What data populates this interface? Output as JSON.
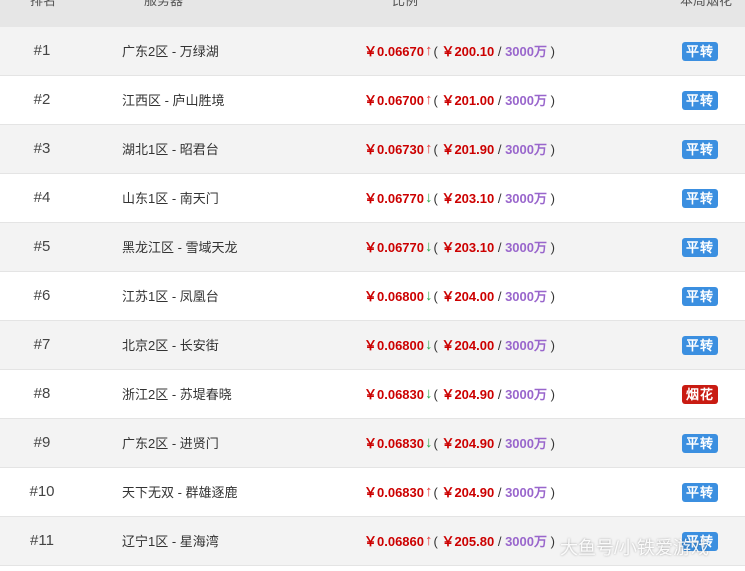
{
  "header": {
    "rank": "排名",
    "server": "服务器",
    "ratio": "比例",
    "status": "本周烟花"
  },
  "colors": {
    "price_red": "#cc0000",
    "count_purple": "#9966cc",
    "arrow_up": "#e83b3b",
    "arrow_down": "#2ea84a",
    "badge_blue": "#3b8fe0",
    "badge_red": "#c91b12"
  },
  "rows": [
    {
      "rank": "#1",
      "server": "广东2区 - 万绿湖",
      "ratio": "￥0.06670",
      "arrow": "↑",
      "price": "￥200.10",
      "count": "3000万",
      "status": "平转"
    },
    {
      "rank": "#2",
      "server": "江西区 - 庐山胜境",
      "ratio": "￥0.06700",
      "arrow": "↑",
      "price": "￥201.00",
      "count": "3000万",
      "status": "平转"
    },
    {
      "rank": "#3",
      "server": "湖北1区 - 昭君台",
      "ratio": "￥0.06730",
      "arrow": "↑",
      "price": "￥201.90",
      "count": "3000万",
      "status": "平转"
    },
    {
      "rank": "#4",
      "server": "山东1区 - 南天门",
      "ratio": "￥0.06770",
      "arrow": "↓",
      "price": "￥203.10",
      "count": "3000万",
      "status": "平转"
    },
    {
      "rank": "#5",
      "server": "黑龙江区 - 雪域天龙",
      "ratio": "￥0.06770",
      "arrow": "↓",
      "price": "￥203.10",
      "count": "3000万",
      "status": "平转"
    },
    {
      "rank": "#6",
      "server": "江苏1区 - 凤凰台",
      "ratio": "￥0.06800",
      "arrow": "↓",
      "price": "￥204.00",
      "count": "3000万",
      "status": "平转"
    },
    {
      "rank": "#7",
      "server": "北京2区 - 长安街",
      "ratio": "￥0.06800",
      "arrow": "↓",
      "price": "￥204.00",
      "count": "3000万",
      "status": "平转"
    },
    {
      "rank": "#8",
      "server": "浙江2区 - 苏堤春晓",
      "ratio": "￥0.06830",
      "arrow": "↓",
      "price": "￥204.90",
      "count": "3000万",
      "status": "烟花"
    },
    {
      "rank": "#9",
      "server": "广东2区 - 进贤门",
      "ratio": "￥0.06830",
      "arrow": "↓",
      "price": "￥204.90",
      "count": "3000万",
      "status": "平转"
    },
    {
      "rank": "#10",
      "server": "天下无双 - 群雄逐鹿",
      "ratio": "￥0.06830",
      "arrow": "↑",
      "price": "￥204.90",
      "count": "3000万",
      "status": "平转"
    },
    {
      "rank": "#11",
      "server": "辽宁1区 - 星海湾",
      "ratio": "￥0.06860",
      "arrow": "↑",
      "price": "￥205.80",
      "count": "3000万",
      "status": "平转"
    }
  ],
  "watermark": "大鱼号/小铁爱游戏"
}
